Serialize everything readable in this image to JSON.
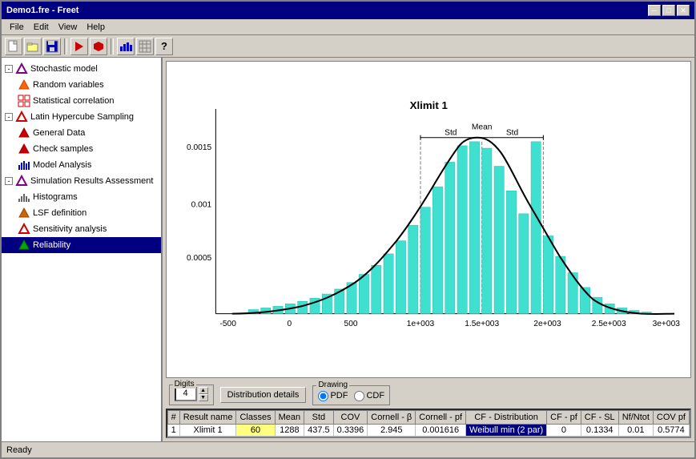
{
  "window": {
    "title": "Demo1.fre - Freet",
    "min_btn": "─",
    "max_btn": "□",
    "close_btn": "✕"
  },
  "menu": {
    "items": [
      "File",
      "Edit",
      "View",
      "Help"
    ]
  },
  "toolbar": {
    "buttons": [
      "📄",
      "📂",
      "💾",
      "🔧",
      "🔧",
      "📊",
      "📋",
      "❓"
    ]
  },
  "tree": {
    "items": [
      {
        "id": "stochastic",
        "label": "Stochastic model",
        "level": 1,
        "expanded": true,
        "icon": "triangle"
      },
      {
        "id": "random",
        "label": "Random variables",
        "level": 2,
        "icon": "tri-orange"
      },
      {
        "id": "correlation",
        "label": "Statistical correlation",
        "level": 2,
        "icon": "grid-red"
      },
      {
        "id": "lhs",
        "label": "Latin Hypercube Sampling",
        "level": 1,
        "expanded": true,
        "icon": "tri-red"
      },
      {
        "id": "general",
        "label": "General Data",
        "level": 2,
        "icon": "tri-red"
      },
      {
        "id": "check",
        "label": "Check samples",
        "level": 2,
        "icon": "tri-red"
      },
      {
        "id": "model-analysis",
        "label": "Model Analysis",
        "level": 2,
        "icon": "chart-blue"
      },
      {
        "id": "simulation",
        "label": "Simulation Results Assessment",
        "level": 1,
        "expanded": true,
        "icon": "tri-purple"
      },
      {
        "id": "histograms",
        "label": "Histograms",
        "level": 2,
        "icon": "bar-gray"
      },
      {
        "id": "lsf",
        "label": "LSF definition",
        "level": 2,
        "icon": "tri-orange"
      },
      {
        "id": "sensitivity",
        "label": "Sensitivity analysis",
        "level": 2,
        "icon": "tri-red"
      },
      {
        "id": "reliability",
        "label": "Reliability",
        "level": 2,
        "icon": "tri-green",
        "selected": true
      }
    ]
  },
  "chart": {
    "title": "Xlimit 1",
    "x_labels": [
      "-500",
      "0",
      "500",
      "1e+003",
      "1.5e+003",
      "2e+003",
      "2.5e+003",
      "3e+003"
    ],
    "y_labels": [
      "0.0015",
      "0.001",
      "0.0005"
    ],
    "mean_label": "Mean",
    "std_label": "Std",
    "y_max": 0.0017
  },
  "controls": {
    "digits_label": "Digits",
    "digits_value": "4",
    "dist_details_btn": "Distribution details",
    "drawing_label": "Drawing",
    "pdf_label": "PDF",
    "cdf_label": "CDF",
    "pdf_selected": true
  },
  "table": {
    "headers": [
      "#",
      "Result name",
      "Classes",
      "Mean",
      "Std",
      "COV",
      "Cornell - β",
      "Cornell - pf",
      "CF - Distribution",
      "CF - pf",
      "CF - SL",
      "Nf/Ntot",
      "COV pf"
    ],
    "rows": [
      {
        "num": "1",
        "name": "Xlimit 1",
        "classes": "60",
        "mean": "1288",
        "std": "437.5",
        "cov": "0.3396",
        "cornell_b": "2.945",
        "cornell_pf": "0.001616",
        "cf_dist": "Weibull min (2 par)",
        "cf_pf": "0",
        "cf_sl": "0.1334",
        "nf_ntot": "0.01",
        "cov_pf": "0.5774"
      }
    ]
  },
  "status": {
    "text": "Ready"
  }
}
